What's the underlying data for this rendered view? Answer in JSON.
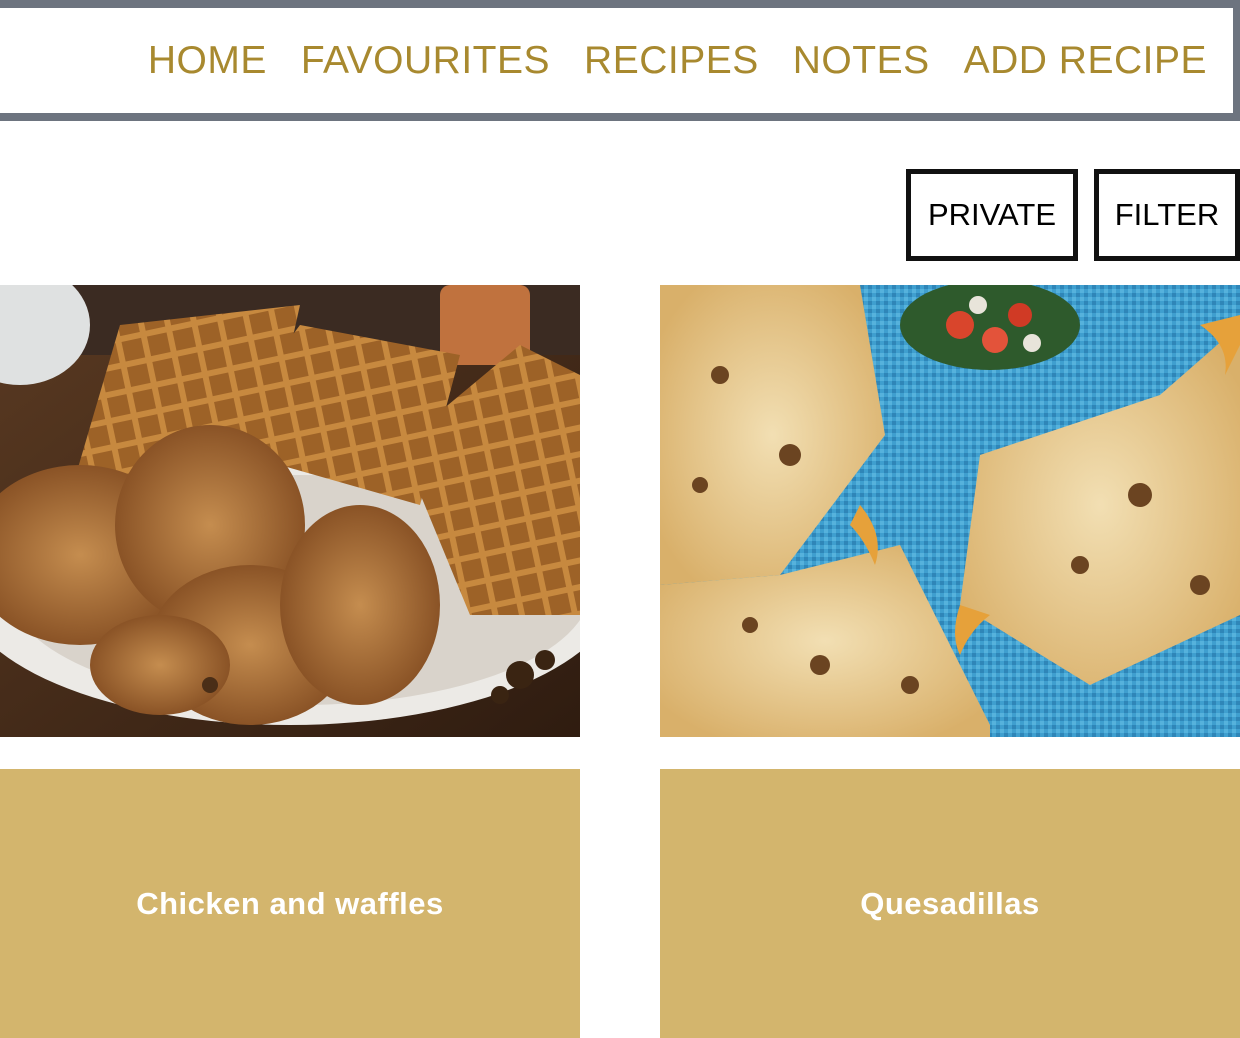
{
  "nav": {
    "items": [
      {
        "label": "HOME"
      },
      {
        "label": "FAVOURITES"
      },
      {
        "label": "RECIPES"
      },
      {
        "label": "NOTES"
      },
      {
        "label": "ADD RECIPE"
      }
    ]
  },
  "toolbar": {
    "private_label": "PRIVATE",
    "filter_label": "FILTER"
  },
  "recipes": [
    {
      "title": "Chicken and waffles",
      "photo_icon": "chicken-and-waffles-photo"
    },
    {
      "title": "Quesadillas",
      "photo_icon": "quesadillas-photo"
    }
  ],
  "colors": {
    "nav_text": "#a8892f",
    "header_border": "#6d747f",
    "card_label_bg": "#d3b56d",
    "card_label_text": "#ffffff"
  }
}
